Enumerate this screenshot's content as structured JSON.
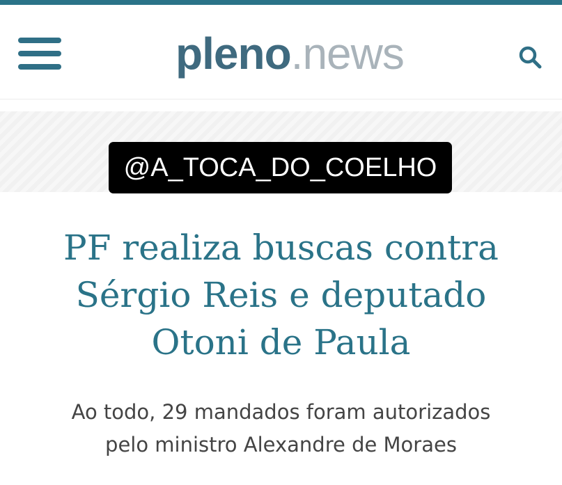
{
  "header": {
    "logo_brand": "pleno",
    "logo_tld": ".news",
    "accent_color": "#2a7388",
    "menu_icon": "hamburger-menu-icon",
    "search_icon": "search-icon"
  },
  "watermark": {
    "text": "@A_TOCA_DO_COELHO"
  },
  "article": {
    "headline_line1": "PF realiza buscas contra",
    "headline_line2": "Sérgio Reis e deputado",
    "headline_line3": "Otoni de Paula",
    "subtitle_line1": "Ao todo, 29 mandados foram autorizados",
    "subtitle_line2": "pelo ministro Alexandre de Moraes"
  }
}
